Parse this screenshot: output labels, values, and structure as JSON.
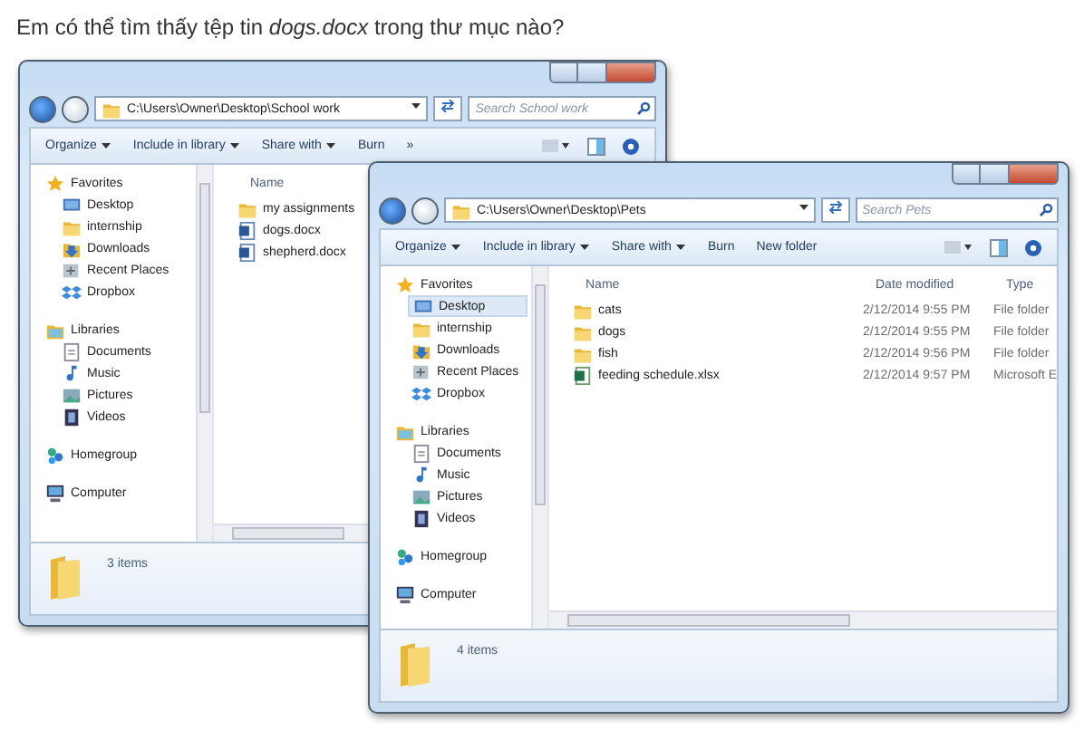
{
  "question": "Em có thể tìm thấy tệp tin *dogs.docx* trong thư mục nào?",
  "windows": [
    {
      "address": "C:\\Users\\Owner\\Desktop\\School work",
      "search": {
        "placeholder": "Search School work"
      },
      "toolbar": [
        {
          "label": "Organize",
          "dropdown": true
        },
        {
          "label": "Include in library",
          "dropdown": true
        },
        {
          "label": "Share with",
          "dropdown": true
        },
        {
          "label": "Burn",
          "dropdown": false
        },
        {
          "label": "»",
          "dropdown": false
        }
      ],
      "sidebar": [
        {
          "label": "Favorites",
          "kind": "star",
          "children": [
            {
              "label": "Desktop",
              "kind": "desktop",
              "selected": false
            },
            {
              "label": "internship",
              "kind": "folder",
              "selected": false
            },
            {
              "label": "Downloads",
              "kind": "downloads",
              "selected": false
            },
            {
              "label": "Recent Places",
              "kind": "recent",
              "selected": false
            },
            {
              "label": "Dropbox",
              "kind": "dropbox",
              "selected": false
            }
          ]
        },
        {
          "label": "Libraries",
          "kind": "libraries",
          "children": [
            {
              "label": "Documents",
              "kind": "document",
              "selected": false
            },
            {
              "label": "Music",
              "kind": "music",
              "selected": false
            },
            {
              "label": "Pictures",
              "kind": "pictures",
              "selected": false
            },
            {
              "label": "Videos",
              "kind": "videos",
              "selected": false
            }
          ]
        },
        {
          "label": "Homegroup",
          "kind": "homegroup"
        },
        {
          "label": "Computer",
          "kind": "computer"
        }
      ],
      "columns": [
        "Name"
      ],
      "files": [
        {
          "kind": "folder",
          "cells": [
            "my assignments"
          ]
        },
        {
          "kind": "word",
          "cells": [
            "dogs.docx"
          ]
        },
        {
          "kind": "word",
          "cells": [
            "shepherd.docx"
          ]
        }
      ],
      "status": "3 items"
    },
    {
      "address": "C:\\Users\\Owner\\Desktop\\Pets",
      "search": {
        "placeholder": "Search Pets"
      },
      "toolbar": [
        {
          "label": "Organize",
          "dropdown": true
        },
        {
          "label": "Include in library",
          "dropdown": true
        },
        {
          "label": "Share with",
          "dropdown": true
        },
        {
          "label": "Burn",
          "dropdown": false
        },
        {
          "label": "New folder",
          "dropdown": false
        }
      ],
      "sidebar": [
        {
          "label": "Favorites",
          "kind": "star",
          "children": [
            {
              "label": "Desktop",
              "kind": "desktop",
              "selected": true
            },
            {
              "label": "internship",
              "kind": "folder",
              "selected": false
            },
            {
              "label": "Downloads",
              "kind": "downloads",
              "selected": false
            },
            {
              "label": "Recent Places",
              "kind": "recent",
              "selected": false
            },
            {
              "label": "Dropbox",
              "kind": "dropbox",
              "selected": false
            }
          ]
        },
        {
          "label": "Libraries",
          "kind": "libraries",
          "children": [
            {
              "label": "Documents",
              "kind": "document",
              "selected": false
            },
            {
              "label": "Music",
              "kind": "music",
              "selected": false
            },
            {
              "label": "Pictures",
              "kind": "pictures",
              "selected": false
            },
            {
              "label": "Videos",
              "kind": "videos",
              "selected": false
            }
          ]
        },
        {
          "label": "Homegroup",
          "kind": "homegroup"
        },
        {
          "label": "Computer",
          "kind": "computer"
        }
      ],
      "columns": [
        "Name",
        "Date modified",
        "Type"
      ],
      "files": [
        {
          "kind": "folder",
          "cells": [
            "cats",
            "2/12/2014 9:55 PM",
            "File folder"
          ]
        },
        {
          "kind": "folder",
          "cells": [
            "dogs",
            "2/12/2014 9:55 PM",
            "File folder"
          ]
        },
        {
          "kind": "folder",
          "cells": [
            "fish",
            "2/12/2014 9:56 PM",
            "File folder"
          ]
        },
        {
          "kind": "excel",
          "cells": [
            "feeding schedule.xlsx",
            "2/12/2014 9:57 PM",
            "Microsoft E"
          ]
        }
      ],
      "status": "4 items"
    }
  ]
}
